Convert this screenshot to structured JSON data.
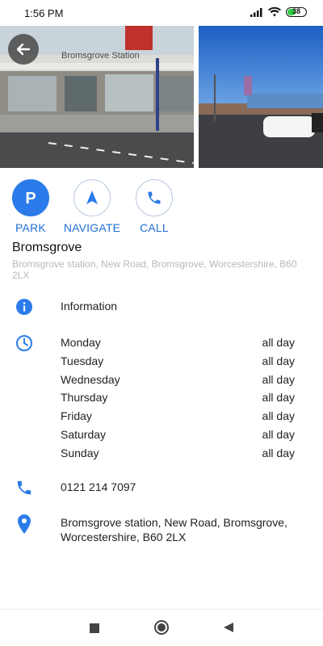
{
  "status_bar": {
    "time": "1:56 PM",
    "battery": "38",
    "icons": [
      "signal-icon",
      "wifi-icon",
      "battery-icon"
    ]
  },
  "photos": {
    "photo1_sign": "Bromsgrove Station",
    "photo1_alt": "Bromsgrove station entrance",
    "photo2_alt": "Bromsgrove station car park"
  },
  "actions": [
    {
      "label": "PARK",
      "icon": "parking-icon"
    },
    {
      "label": "NAVIGATE",
      "icon": "navigate-arrow-icon"
    },
    {
      "label": "CALL",
      "icon": "phone-icon"
    }
  ],
  "place": {
    "name": "Bromsgrove",
    "subtitle": "Bromsgrove station, New Road, Bromsgrove, Worcestershire, B60 2LX"
  },
  "information_label": "Information",
  "hours": [
    {
      "day": "Monday",
      "time": "all day"
    },
    {
      "day": "Tuesday",
      "time": "all day"
    },
    {
      "day": "Wednesday",
      "time": "all day"
    },
    {
      "day": "Thursday",
      "time": "all day"
    },
    {
      "day": "Friday",
      "time": "all day"
    },
    {
      "day": "Saturday",
      "time": "all day"
    },
    {
      "day": "Sunday",
      "time": "all day"
    }
  ],
  "phone": "0121 214 7097",
  "address": "Bromsgrove station, New Road, Bromsgrove, Worcestershire, B60 2LX",
  "colors": {
    "accent": "#2b7bea",
    "accent_text": "#1f6fd1",
    "subtitle": "#b8b8b8"
  },
  "nav": [
    "recents-square-icon",
    "home-circle-icon",
    "back-triangle-icon"
  ]
}
